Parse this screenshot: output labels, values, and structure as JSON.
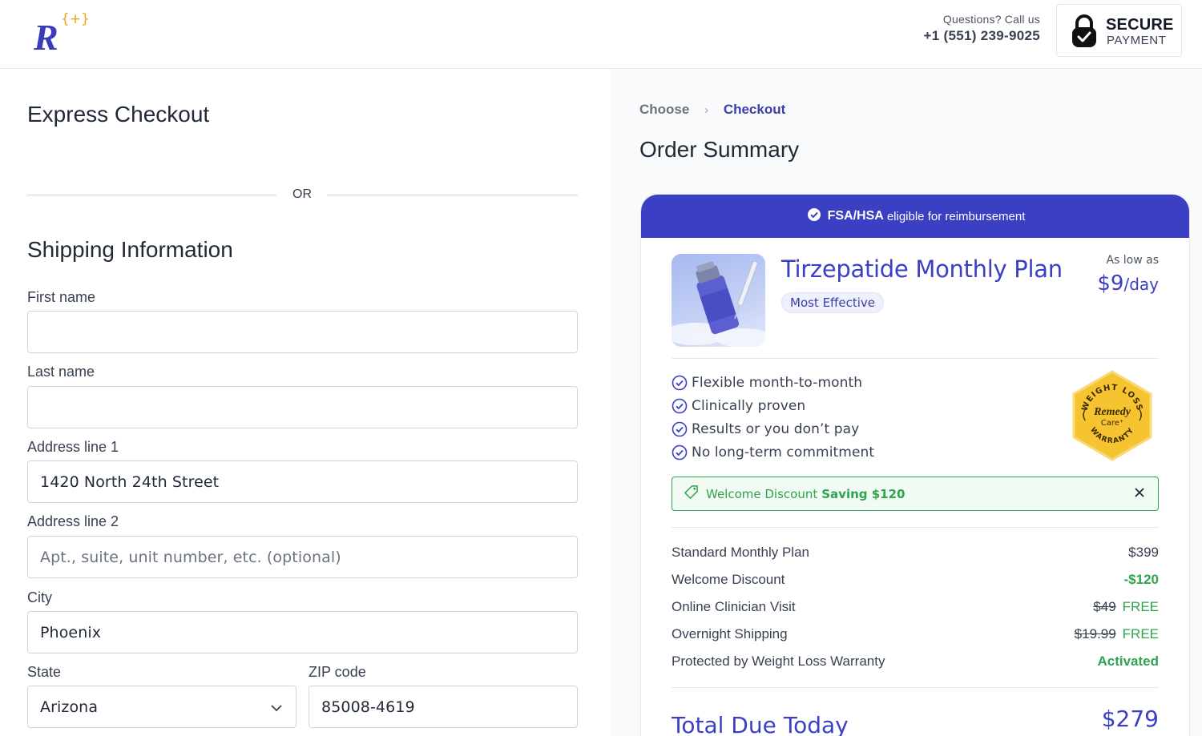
{
  "header": {
    "logo_letter": "R",
    "logo_mark": "{+}",
    "contact_question": "Questions? Call us",
    "contact_phone": "+1 (551) 239-9025",
    "secure_title": "SECURE",
    "secure_subtitle": "PAYMENT",
    "secure_icon": "lock-icon"
  },
  "left": {
    "express_title": "Express Checkout",
    "or_text": "OR",
    "shipping_title": "Shipping Information",
    "fields": {
      "first_name": {
        "label": "First name",
        "value": "",
        "placeholder": ""
      },
      "last_name": {
        "label": "Last name",
        "value": "",
        "placeholder": ""
      },
      "address1": {
        "label": "Address line 1",
        "value": "1420 North 24th Street"
      },
      "address2": {
        "label": "Address line 2",
        "value": "",
        "placeholder": "Apt., suite, unit number, etc. (optional)"
      },
      "city": {
        "label": "City",
        "value": "Phoenix"
      },
      "state": {
        "label": "State",
        "value": "Arizona"
      },
      "zip": {
        "label": "ZIP code",
        "value": "85008-4619"
      }
    }
  },
  "right": {
    "breadcrumb": [
      "Choose",
      "Checkout"
    ],
    "order_summary_title": "Order Summary",
    "fsa_banner": {
      "bold": "FSA/HSA",
      "text": "eligible for reimbursement"
    },
    "product": {
      "title": "Tirzepatide Monthly Plan",
      "badge": "Most Effective",
      "as_low_as": "As low as",
      "price_main": "$9",
      "price_unit": "/day"
    },
    "features": [
      "Flexible month-to-month",
      "Clinically proven",
      "Results or you don’t pay",
      "No long-term commitment"
    ],
    "seal": {
      "top": "WEIGHT LOSS",
      "brand": "Remedy",
      "brand2": "Care⁺",
      "bottom": "WARRANTY"
    },
    "discount": {
      "text": "Welcome Discount",
      "saving": "Saving $120"
    },
    "line_items": [
      {
        "label": "Standard Monthly Plan",
        "value": "$399"
      },
      {
        "label": "Welcome Discount",
        "value": "-$120"
      },
      {
        "label": "Online Clinician Visit",
        "strike": "$49",
        "value": "FREE"
      },
      {
        "label": "Overnight Shipping",
        "strike": "$19.99",
        "value": "FREE"
      },
      {
        "label": "Protected by Weight Loss Warranty",
        "value": "Activated"
      }
    ],
    "total_label": "Total Due Today",
    "total_value": "$279"
  },
  "colors": {
    "brand_blue": "#3b3fc4",
    "success_green": "#2ea44f",
    "accent_orange": "#f0a020"
  }
}
